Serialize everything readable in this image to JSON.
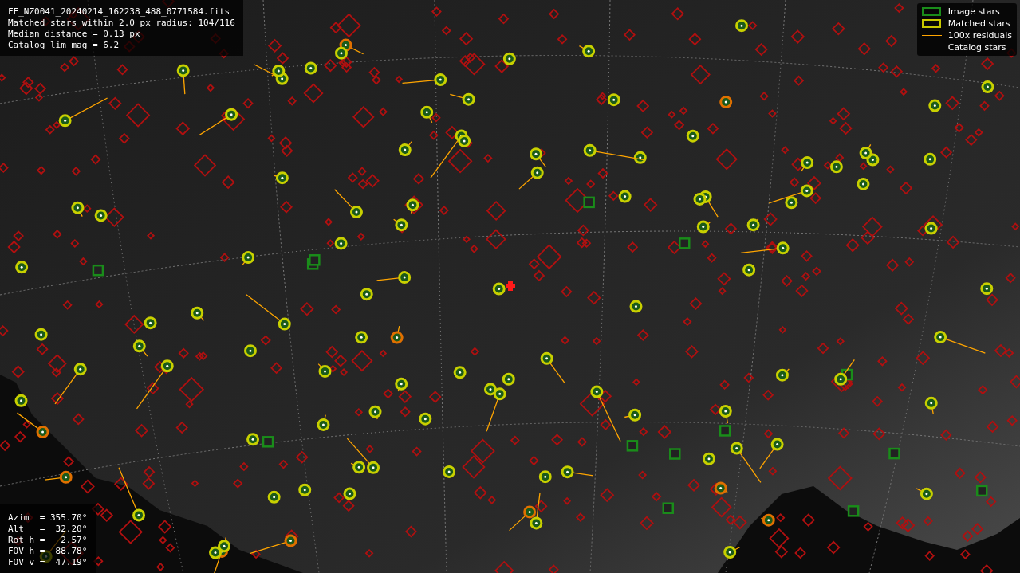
{
  "info": {
    "lines": [
      "FF_NZ0041_20240214_162238_488_0771584.fits",
      "Matched stars within 2.0 px radius: 104/116",
      "Median distance = 0.13 px",
      "Catalog lim mag = 6.2"
    ]
  },
  "legend": [
    {
      "label": "Image stars",
      "kind": "box",
      "color": "#1a8c1a"
    },
    {
      "label": "Matched stars",
      "kind": "box",
      "color": "#c8c800"
    },
    {
      "label": "100x residuals",
      "kind": "line",
      "color": "#ffa500"
    },
    {
      "label": "Catalog stars",
      "kind": "none"
    }
  ],
  "pointing": [
    "Azim  = 355.70°",
    "Alt   =  32.20°",
    "Rot h =   2.57°",
    "FOV h =  88.78°",
    "FOV v =  47.19°"
  ]
}
